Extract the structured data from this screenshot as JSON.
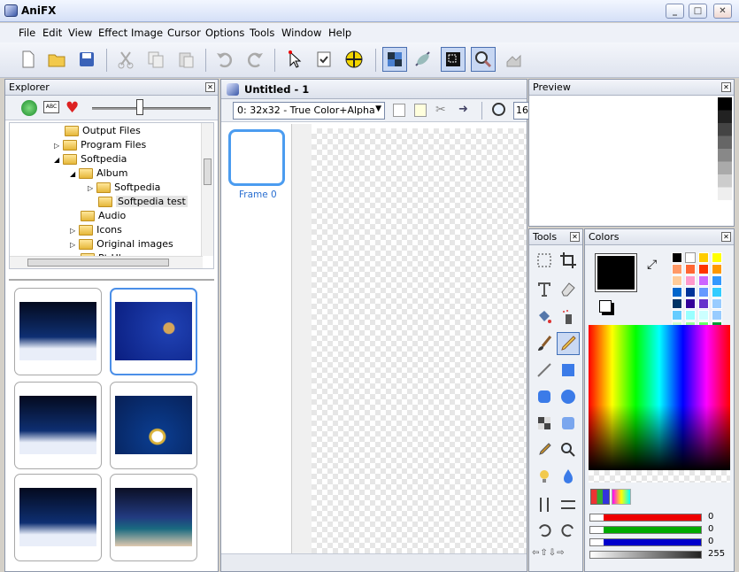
{
  "window": {
    "title": "AniFX"
  },
  "menu": [
    "File",
    "Edit",
    "View",
    "Effect",
    "Image",
    "Cursor",
    "Options",
    "Tools",
    "Window",
    "Help"
  ],
  "toolbar": {
    "icons": [
      "new-file-icon",
      "open-folder-icon",
      "save-disk-icon",
      "cut-icon",
      "copy-icon",
      "paste-icon",
      "undo-icon",
      "redo-icon",
      "cursor-arrow-icon",
      "checklist-icon",
      "hotspot-icon",
      "checker-grid-icon",
      "satellite-icon",
      "image-preview-icon",
      "zoom-icon",
      "export-icon"
    ]
  },
  "explorer": {
    "title": "Explorer",
    "tree": [
      {
        "label": "Output Files",
        "level": 1
      },
      {
        "label": "Program Files",
        "level": 1
      },
      {
        "label": "Softpedia",
        "level": 1
      },
      {
        "label": "Album",
        "level": 2
      },
      {
        "label": "Softpedia",
        "level": 3
      },
      {
        "label": "Softpedia test",
        "level": 3,
        "selected": true
      },
      {
        "label": "Audio",
        "level": 2
      },
      {
        "label": "Icons",
        "level": 2
      },
      {
        "label": "Original images",
        "level": 2
      },
      {
        "label": "Pt Hlp",
        "level": 2
      }
    ]
  },
  "document": {
    "tab_title": "Untitled - 1",
    "format_selected": "0: 32x32 - True Color+Alpha",
    "zoom_value": "16",
    "frame_label": "Frame 0"
  },
  "preview": {
    "title": "Preview"
  },
  "tools": {
    "title": "Tools"
  },
  "colors": {
    "title": "Colors",
    "primary": "#000000",
    "rgb": {
      "red": "0",
      "green": "0",
      "blue": "0"
    },
    "alpha": "255",
    "palette": [
      "#000000",
      "#ffffff",
      "#ffcc00",
      "#ffff00",
      "#ff9966",
      "#ff6633",
      "#ff3300",
      "#ff9900",
      "#ffcc99",
      "#ff99cc",
      "#cc66ff",
      "#3399ff",
      "#0066cc",
      "#003399",
      "#6699ff",
      "#33ccff",
      "#003366",
      "#330099",
      "#6633cc",
      "#99ccff",
      "#66ccff",
      "#99ffff",
      "#ccffff",
      "#99ccff",
      "#ccffcc",
      "#99ff99",
      "#66ff66",
      "#009933",
      "#006600",
      "#33cc33",
      "#66cc00",
      "#99cc00"
    ]
  }
}
